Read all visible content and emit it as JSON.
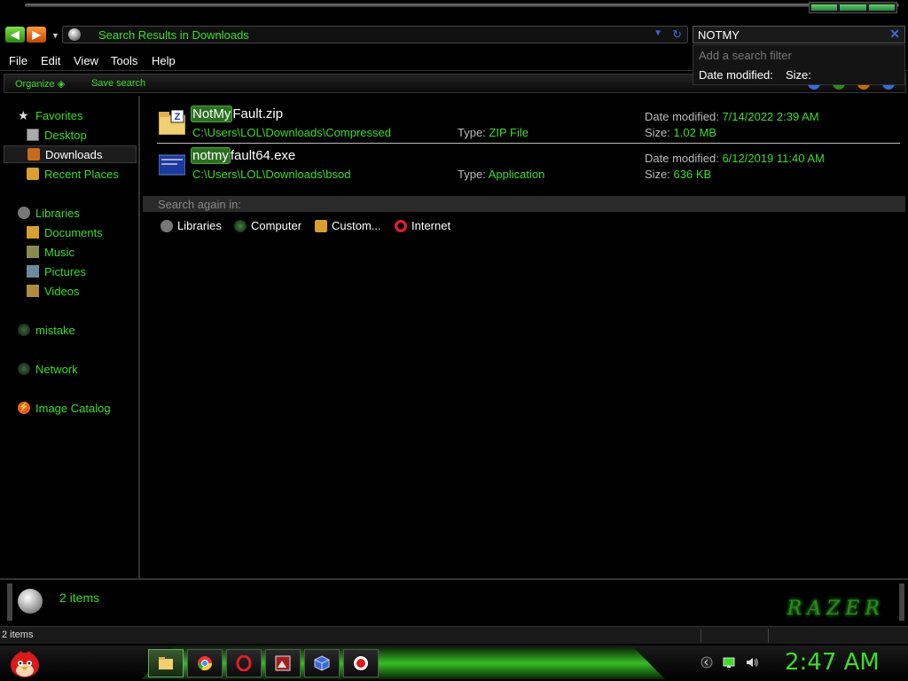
{
  "address": {
    "text": "Search Results in Downloads"
  },
  "search": {
    "value": "NOTMY",
    "filter_placeholder": "Add a search filter",
    "filters": [
      "Date modified:",
      "Size:"
    ]
  },
  "menu": [
    "File",
    "Edit",
    "View",
    "Tools",
    "Help"
  ],
  "command_bar": {
    "organize": "Organize ◈",
    "save_search": "Save search"
  },
  "nav": {
    "favorites": "Favorites",
    "desktop": "Desktop",
    "downloads": "Downloads",
    "recent": "Recent Places",
    "libraries": "Libraries",
    "documents": "Documents",
    "music": "Music",
    "pictures": "Pictures",
    "videos": "Videos",
    "mistake": "mistake",
    "network": "Network",
    "image_catalog": "Image Catalog"
  },
  "results": [
    {
      "name_match": "NotMy",
      "name_rest": "Fault.zip",
      "path": "C:\\Users\\LOL\\Downloads\\Compressed",
      "type_label": "Type:",
      "type": "ZIP File",
      "date_label": "Date modified:",
      "date": "7/14/2022 2:39 AM",
      "size_label": "Size:",
      "size": "1.02 MB"
    },
    {
      "name_match": "notmy",
      "name_rest": "fault64.exe",
      "path": "C:\\Users\\LOL\\Downloads\\bsod",
      "type_label": "Type:",
      "type": "Application",
      "date_label": "Date modified:",
      "date": "6/12/2019 11:40 AM",
      "size_label": "Size:",
      "size": "636 KB"
    }
  ],
  "search_again": {
    "label": "Search again in:",
    "options": [
      "Libraries",
      "Computer",
      "Custom...",
      "Internet"
    ]
  },
  "details": {
    "count": "2 items",
    "brand": "RAZER"
  },
  "status": {
    "text": "2 items"
  },
  "clock": "2:47 AM",
  "colors": {
    "accent": "#3ddc2a",
    "background": "#000000"
  }
}
